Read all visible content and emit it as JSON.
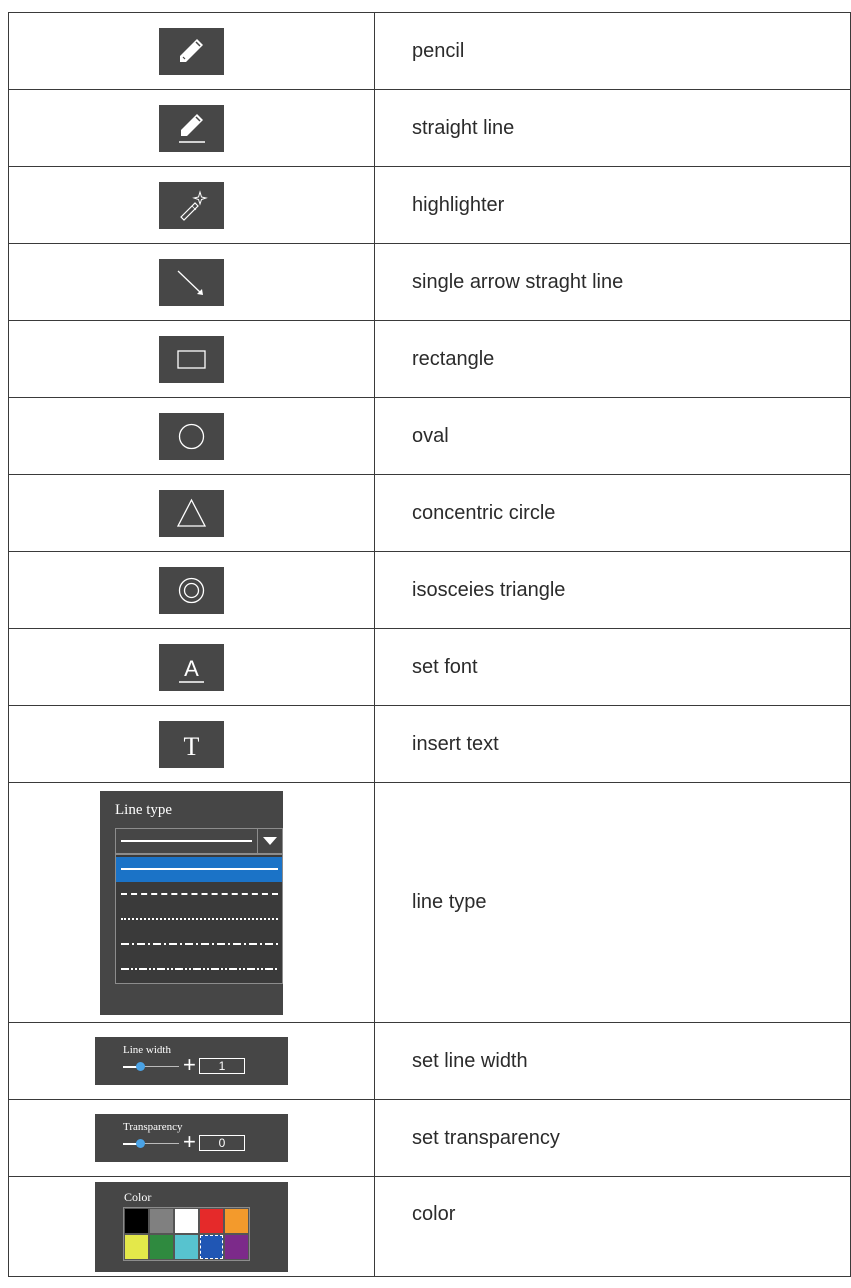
{
  "rows": [
    {
      "icon": "pencil-icon",
      "label": "pencil"
    },
    {
      "icon": "straight-line-icon",
      "label": "straight line"
    },
    {
      "icon": "highlighter-icon",
      "label": "highlighter"
    },
    {
      "icon": "arrow-line-icon",
      "label": "single arrow straght line"
    },
    {
      "icon": "rectangle-icon",
      "label": "rectangle"
    },
    {
      "icon": "oval-icon",
      "label": "oval"
    },
    {
      "icon": "triangle-icon",
      "label": "concentric circle"
    },
    {
      "icon": "concentric-circle-icon",
      "label": "isosceies triangle"
    },
    {
      "icon": "set-font-icon",
      "label": "set font",
      "glyph": "A"
    },
    {
      "icon": "insert-text-icon",
      "label": "insert text",
      "glyph": "T"
    }
  ],
  "line_type": {
    "title": "Line type",
    "label": "line type",
    "options": [
      "solid",
      "dashed",
      "dotted",
      "dash-dot",
      "dash-dot-dot"
    ],
    "selected": "solid"
  },
  "line_width": {
    "title": "Line width",
    "value": "1",
    "label": "set line width"
  },
  "transparency": {
    "title": "Transparency",
    "value": "0",
    "label": "set transparency"
  },
  "color": {
    "title": "Color",
    "label": "color",
    "swatches": [
      "#000000",
      "#808080",
      "#ffffff",
      "#e52a2a",
      "#f39a2c",
      "#e4e84a",
      "#2f8a3f",
      "#57c3cf",
      "#2056b4",
      "#7c2a8a"
    ],
    "selected_index": 8
  }
}
